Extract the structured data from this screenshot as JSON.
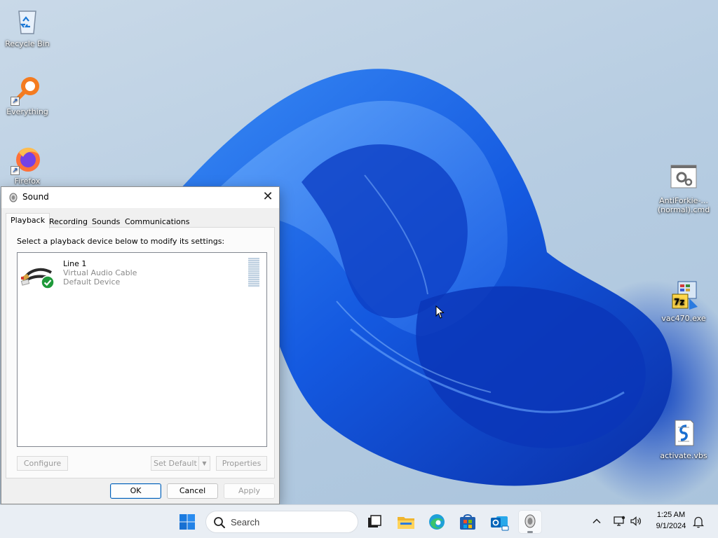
{
  "desktop": {
    "icons": [
      {
        "label": "Recycle Bin",
        "icon": "recycle-bin-icon"
      },
      {
        "label": "Everything",
        "icon": "everything-search-icon"
      },
      {
        "label": "Firefox",
        "icon": "firefox-icon"
      },
      {
        "label": "AntiForkie-...\n(normal).cmd",
        "icon": "cmd-file-icon"
      },
      {
        "label": "vac470.exe",
        "icon": "installer-icon"
      },
      {
        "label": "activate.vbs",
        "icon": "script-file-icon"
      }
    ]
  },
  "dialog": {
    "title": "Sound",
    "close_glyph": "✕",
    "tabs": [
      {
        "label": "Playback",
        "active": true
      },
      {
        "label": "Recording",
        "active": false
      },
      {
        "label": "Sounds",
        "active": false
      },
      {
        "label": "Communications",
        "active": false
      }
    ],
    "instruction": "Select a playback device below to modify its settings:",
    "devices": [
      {
        "name": "Line 1",
        "description": "Virtual Audio Cable",
        "status": "Default Device",
        "icon": "audio-cable-icon",
        "default_badge": "checkmark-icon"
      }
    ],
    "buttons": {
      "configure": "Configure",
      "set_default": "Set Default",
      "properties": "Properties",
      "ok": "OK",
      "cancel": "Cancel",
      "apply": "Apply"
    }
  },
  "taskbar": {
    "search_placeholder": "Search",
    "apps": [
      "start-icon",
      "task-view-icon",
      "file-explorer-icon",
      "edge-icon",
      "store-icon",
      "outlook-icon",
      "sound-app-icon"
    ],
    "tray": [
      "chevron-up-icon",
      "network-icon",
      "volume-icon",
      "notification-bell-icon"
    ],
    "time": "1:25 AM",
    "date": "9/1/2024"
  },
  "colors": {
    "accent": "#005fb8",
    "wallpaper_bloom": "#1a5fe8",
    "taskbar": "#e9eef4"
  }
}
